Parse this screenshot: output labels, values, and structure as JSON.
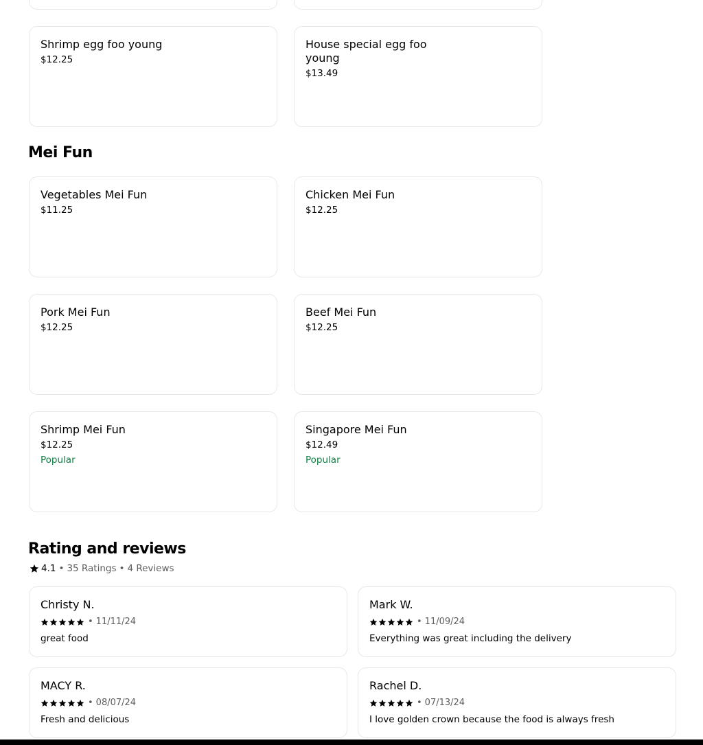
{
  "menu": {
    "partial_cards": [
      "",
      ""
    ],
    "egg_foo_young_items": [
      {
        "name": "Shrimp egg foo young",
        "price": "$12.25"
      },
      {
        "name": "House special egg foo young",
        "price": "$13.49"
      }
    ],
    "mei_fun": {
      "title": "Mei Fun",
      "items": [
        {
          "name": "Vegetables Mei Fun",
          "price": "$11.25",
          "badge": ""
        },
        {
          "name": "Chicken Mei Fun",
          "price": "$12.25",
          "badge": ""
        },
        {
          "name": "Pork Mei Fun",
          "price": "$12.25",
          "badge": ""
        },
        {
          "name": "Beef Mei Fun",
          "price": "$12.25",
          "badge": ""
        },
        {
          "name": "Shrimp Mei Fun",
          "price": "$12.25",
          "badge": "Popular"
        },
        {
          "name": "Singapore Mei Fun",
          "price": "$12.49",
          "badge": "Popular"
        }
      ]
    }
  },
  "reviews_section": {
    "title": "Rating and reviews",
    "rating": "4.1",
    "ratings_count": "35 Ratings",
    "reviews_count": "4 Reviews",
    "separator": "•",
    "star_icon": "star-icon",
    "reviews": [
      {
        "name": "Christy N.",
        "stars": 5,
        "date": "11/11/24",
        "text": "great food"
      },
      {
        "name": "Mark W.",
        "stars": 5,
        "date": "11/09/24",
        "text": "Everything was great including the delivery"
      },
      {
        "name": "MACY R.",
        "stars": 5,
        "date": "08/07/24",
        "text": "Fresh and delicious"
      },
      {
        "name": "Rachel D.",
        "stars": 5,
        "date": "07/13/24",
        "text": "I love golden crown because the food is always fresh"
      }
    ]
  },
  "colors": {
    "popular_badge": "#0e8345",
    "card_border": "#e8e8e8",
    "muted_text": "#5e5e5e"
  }
}
